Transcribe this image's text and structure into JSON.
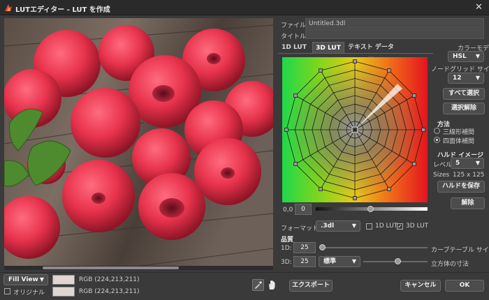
{
  "window": {
    "title": "LUTエディター - LUT を作成",
    "close_glyph": "✕"
  },
  "top_fields": {
    "filename_label": "ファイル名",
    "filename_value": "Untitled.3dl",
    "title_label": "タイトル",
    "title_value": ""
  },
  "tabs": [
    {
      "label": "1D LUT"
    },
    {
      "label": "3D LUT"
    },
    {
      "label": "テキスト データー"
    }
  ],
  "right_panel": {
    "color_model_label": "カラーモデル",
    "color_model_value": "HSL",
    "grid_size_label": "ノードグリッド サイズ",
    "grid_size_value": "12",
    "select_all": "すべて選択",
    "deselect": "選択解除",
    "method_label": "方法",
    "method_options": [
      "三線形補間",
      "四面体補間"
    ],
    "hald_label": "ハルド イメージ",
    "level_label": "レベル",
    "level_value": "5",
    "sizes_label": "Sizes",
    "sizes_value": "125 x 125",
    "save_hald": "ハルドを保存",
    "release": "解除"
  },
  "lut_controls": {
    "value_label": "0,0",
    "value": "0",
    "format_label": "フォーマット",
    "format_value": ".3dl",
    "check_1d": "1D LUT",
    "check_3d": "3D LUT"
  },
  "quality": {
    "label": "品質",
    "row1_label": "1D:",
    "row1_value": "25",
    "row1_desc": "カーブテーブル サイズ",
    "row2_label": "3D:",
    "row2_value": "25",
    "row2_select": "標準",
    "row2_desc": "立方体の寸法"
  },
  "bottom_bar": {
    "view_mode": "Fill View",
    "rgb_top": "RGB (224,213,211)",
    "original_label": "オリジナル",
    "rgb_bottom": "RGB (224,213,211)",
    "export": "エクスポート",
    "cancel": "キャンセル",
    "ok": "OK"
  },
  "colors": {
    "accent": "#e0d5d3",
    "background": "#3a3a3a",
    "title_bg": "#2a2a2a"
  }
}
